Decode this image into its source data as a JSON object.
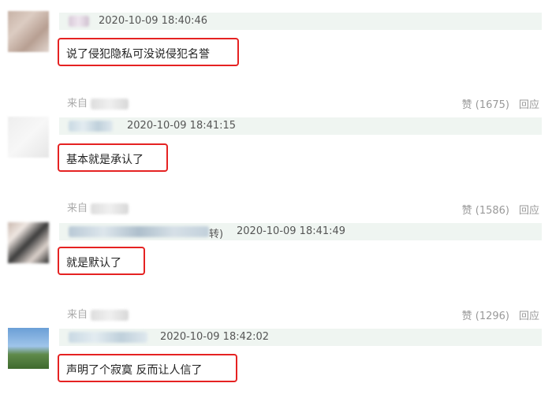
{
  "comments": [
    {
      "name_suffix": "",
      "timestamp": "2020-10-09 18:40:46",
      "reply": "说了侵犯隐私可没说侵犯名誉",
      "source_label": "来自",
      "like_label": "赞 (1675)",
      "reply_label": "回应"
    },
    {
      "name_suffix": "",
      "timestamp": "2020-10-09 18:41:15",
      "reply": "基本就是承认了",
      "source_label": "来自",
      "like_label": "赞 (1586)",
      "reply_label": "回应"
    },
    {
      "name_suffix": "转)",
      "timestamp": "2020-10-09 18:41:49",
      "reply": "就是默认了",
      "source_label": "来自",
      "like_label": "赞 (1296)",
      "reply_label": "回应"
    },
    {
      "name_suffix": "",
      "timestamp": "2020-10-09 18:42:02",
      "reply": "声明了个寂寞 反而让人信了"
    }
  ],
  "colors": {
    "highlight_border": "#e52222",
    "meta_bar": "#eff5f1"
  }
}
